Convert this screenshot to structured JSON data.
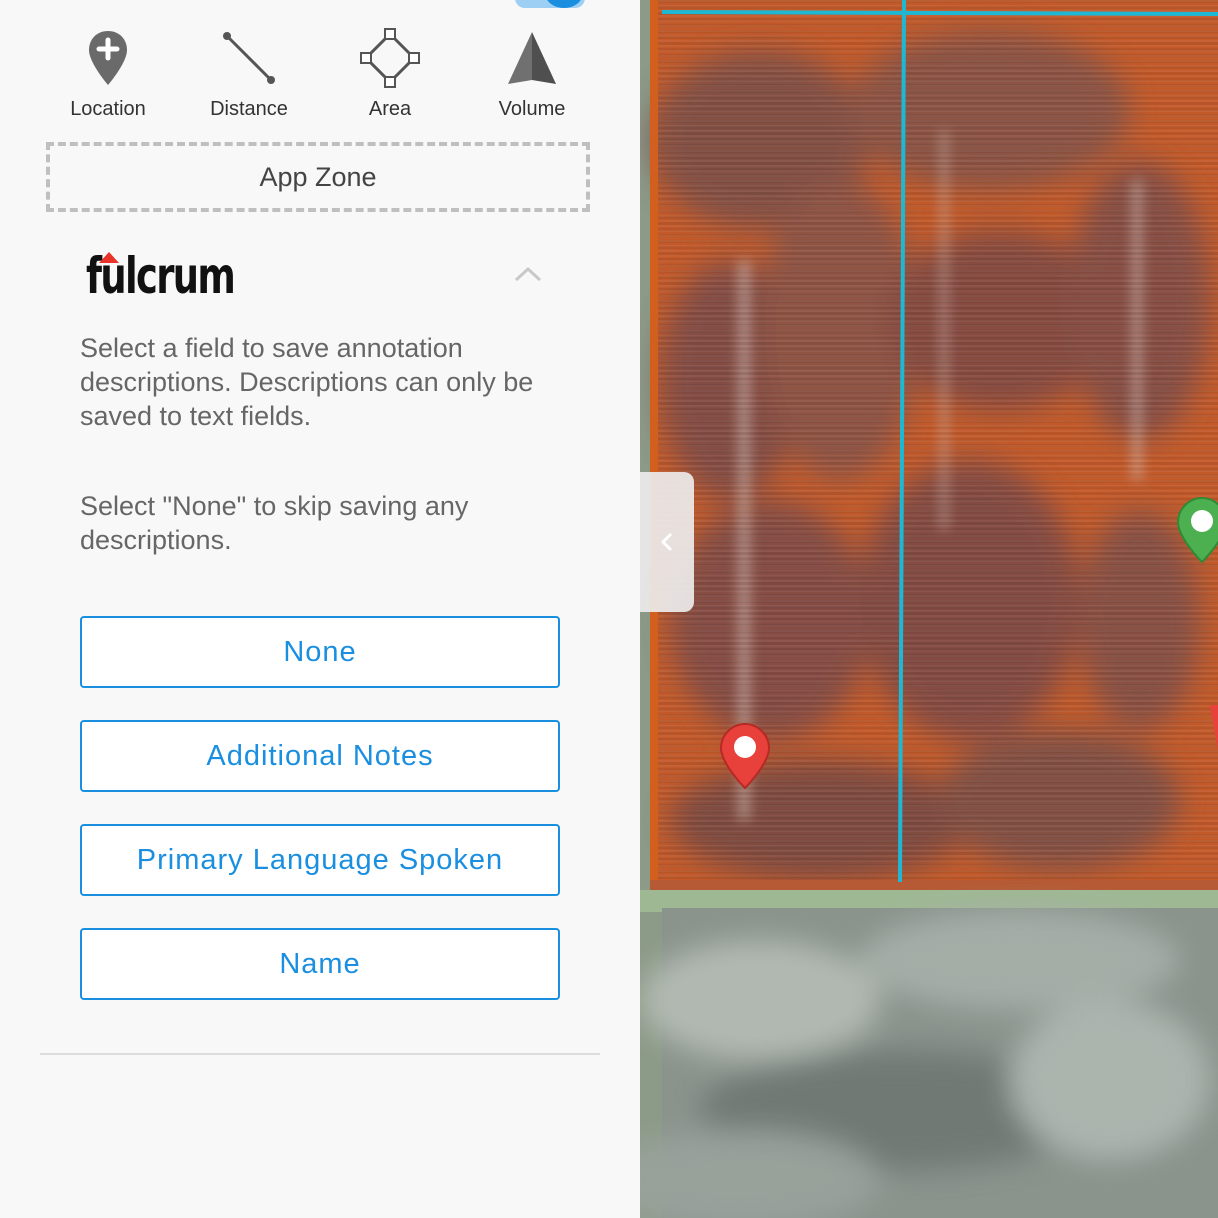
{
  "tools": [
    {
      "label": "Location",
      "icon": "location-pin-add-icon"
    },
    {
      "label": "Distance",
      "icon": "ruler-line-icon"
    },
    {
      "label": "Area",
      "icon": "polygon-area-icon"
    },
    {
      "label": "Volume",
      "icon": "volume-pyramid-icon"
    }
  ],
  "app_zone": {
    "label": "App Zone"
  },
  "fulcrum": {
    "logo_text": "fulcrum",
    "description_1": "Select a field to save annotation descriptions. Descriptions can only be saved to text fields.",
    "description_2": "Select \"None\" to skip saving any descriptions.",
    "fields": [
      "None",
      "Additional Notes",
      "Primary Language Spoken",
      "Name"
    ]
  },
  "colors": {
    "accent": "#1a8fe0",
    "field_boundary": "#1fb8d4",
    "pin_red": "#e8403a",
    "pin_green": "#4cb050",
    "field_orange": "#c35a2a"
  }
}
